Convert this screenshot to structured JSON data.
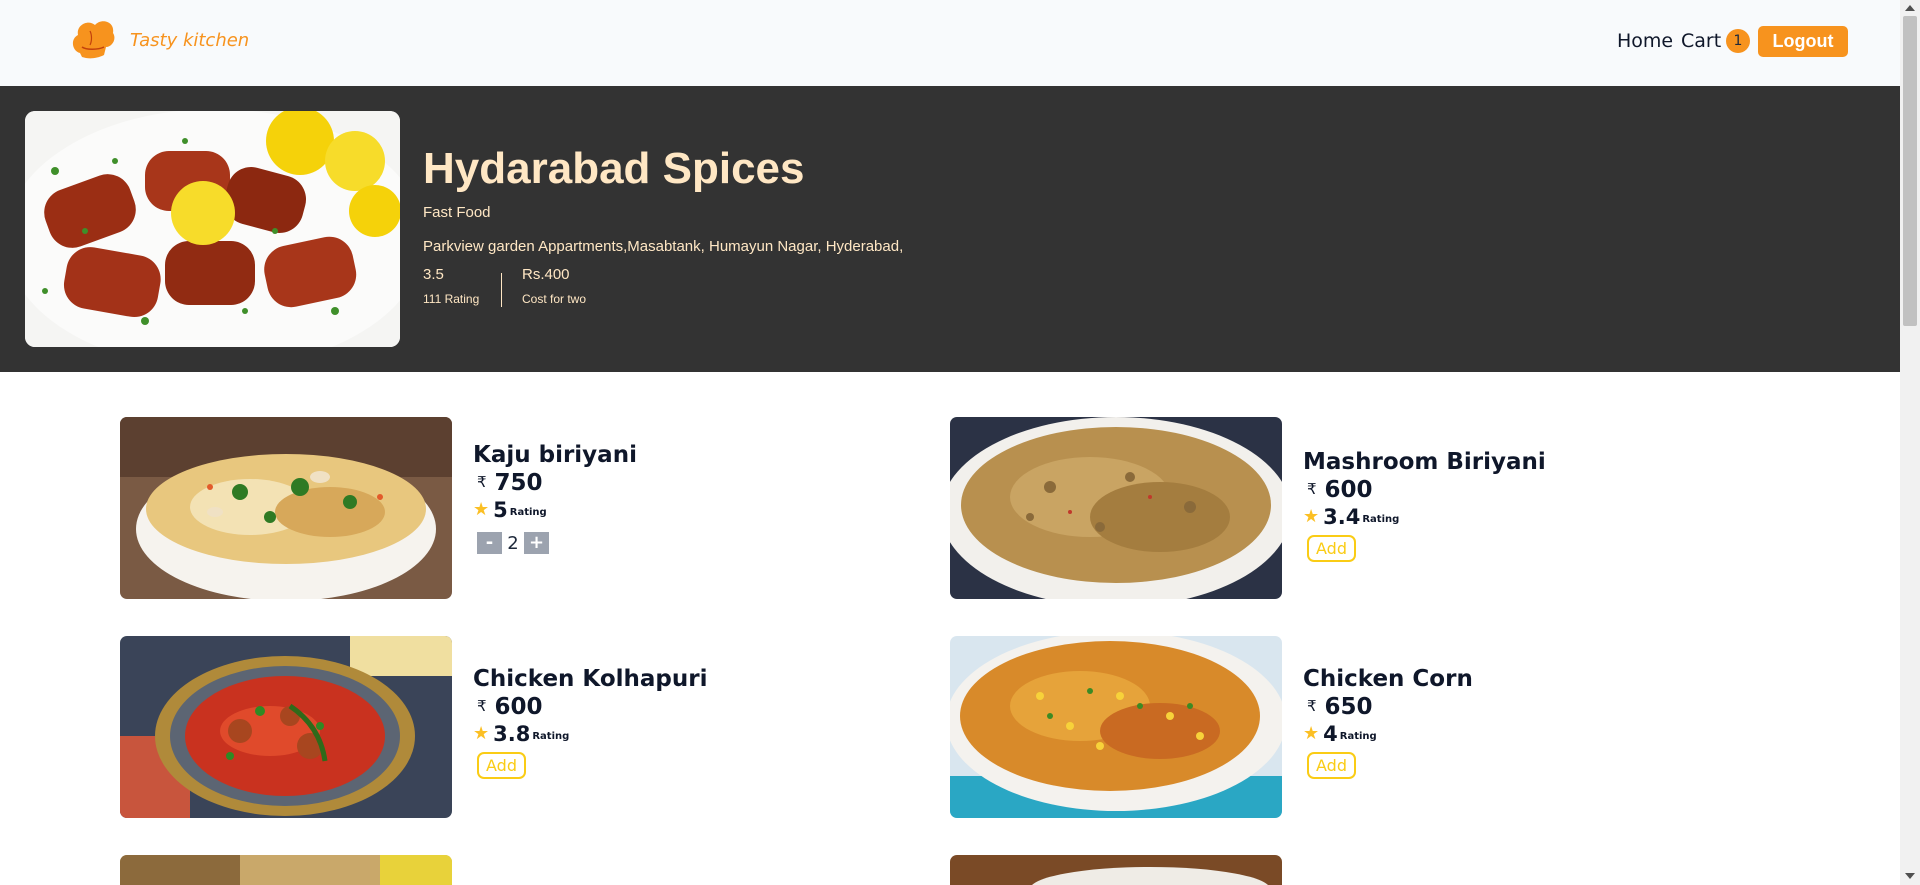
{
  "navbar": {
    "brand": "Tasty kitchen",
    "home_label": "Home",
    "cart_label": "Cart",
    "cart_count": "1",
    "logout_label": "Logout"
  },
  "restaurant": {
    "name": "Hydarabad Spices",
    "cuisine": "Fast Food",
    "address": "Parkview garden Appartments,Masabtank, Humayun Nagar, Hyderabad,",
    "rating": "3.5",
    "rating_label": "111 Rating",
    "cost": "Rs.400",
    "cost_label": "Cost for two"
  },
  "food_items": [
    {
      "name": "Kaju biriyani",
      "currency": "₹",
      "price": "750",
      "rating": "5",
      "rating_label": "Rating",
      "in_cart": true,
      "quantity": "2",
      "minus": "-",
      "plus": "+"
    },
    {
      "name": "Mashroom Biriyani",
      "currency": "₹",
      "price": "600",
      "rating": "3.4",
      "rating_label": "Rating",
      "in_cart": false,
      "add_label": "Add"
    },
    {
      "name": "Chicken Kolhapuri",
      "currency": "₹",
      "price": "600",
      "rating": "3.8",
      "rating_label": "Rating",
      "in_cart": false,
      "add_label": "Add"
    },
    {
      "name": "Chicken Corn",
      "currency": "₹",
      "price": "650",
      "rating": "4",
      "rating_label": "Rating",
      "in_cart": false,
      "add_label": "Add"
    }
  ],
  "icons": {
    "logo": "chef-hat-icon",
    "rating": "star-icon"
  },
  "colors": {
    "accent": "#f7931e",
    "banner_bg": "#333333",
    "banner_text": "#ffe7c4",
    "star": "#fbbf24",
    "add_border": "#facc15"
  }
}
